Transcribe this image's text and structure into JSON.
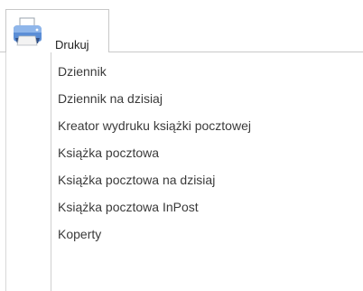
{
  "tab": {
    "label": "Drukuj",
    "icon": "printer-icon"
  },
  "menu": {
    "items": [
      {
        "label": "Dziennik"
      },
      {
        "label": "Dziennik na dzisiaj"
      },
      {
        "label": "Kreator wydruku książki pocztowej"
      },
      {
        "label": "Książka pocztowa"
      },
      {
        "label": "Książka pocztowa na dzisiaj"
      },
      {
        "label": "Książka pocztowa InPost"
      },
      {
        "label": "Koperty"
      }
    ]
  }
}
